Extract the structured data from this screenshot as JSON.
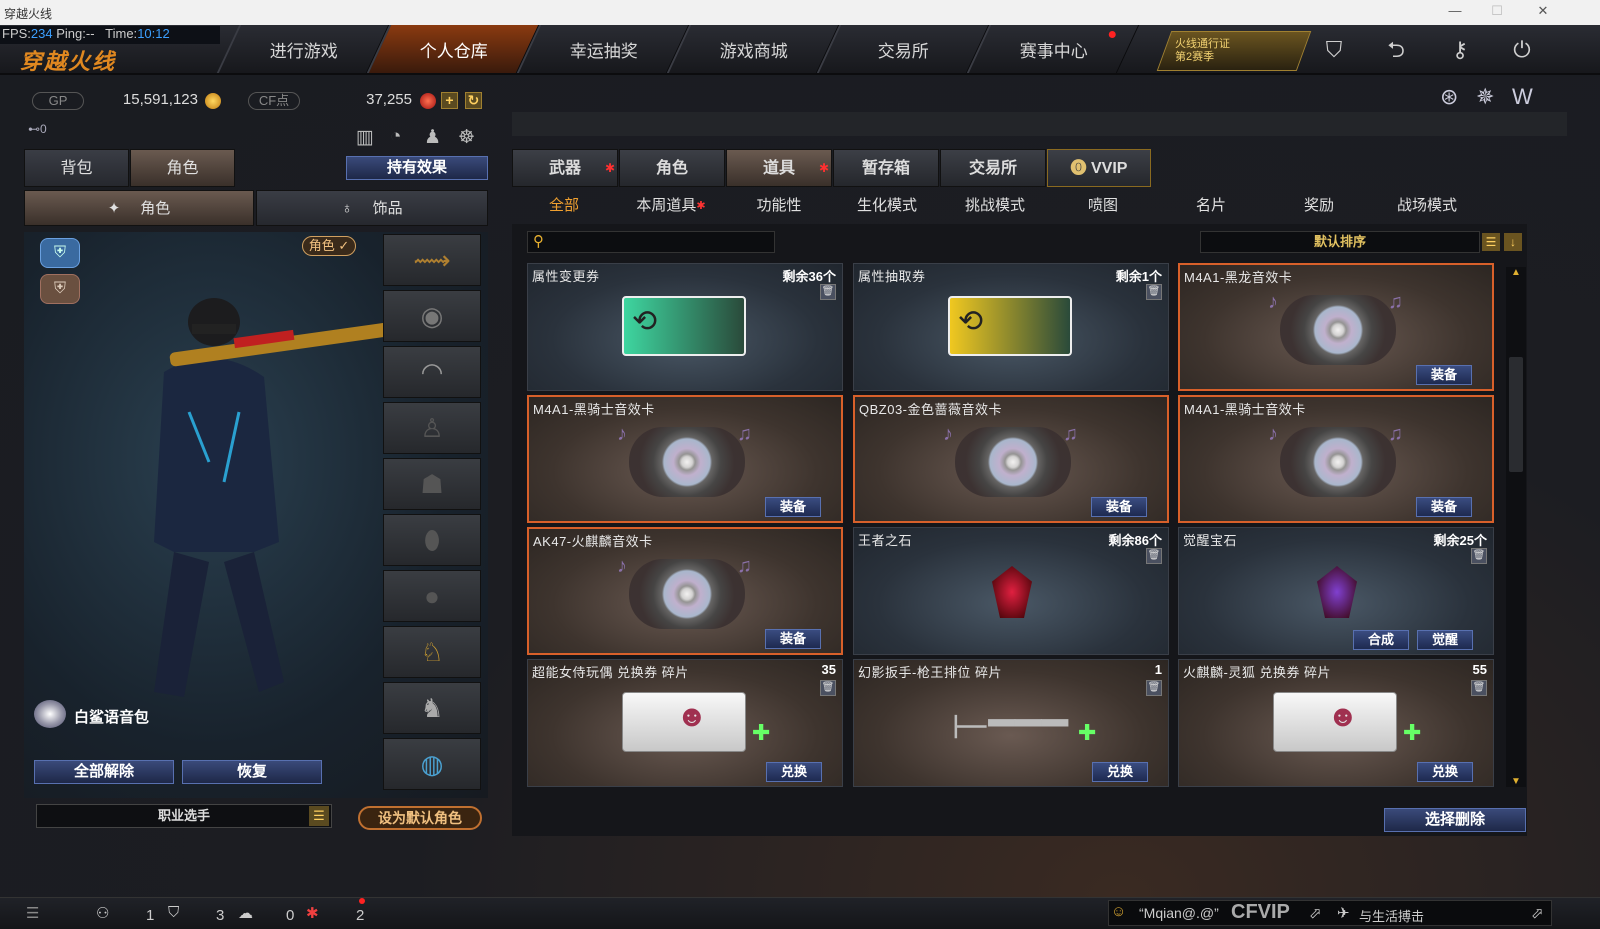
{
  "window": {
    "title": "穿越火线",
    "minimize": "—",
    "maximize": "☐",
    "close": "✕"
  },
  "hud": {
    "fps_label": "FPS:",
    "fps": "234",
    "ping_label": "Ping:",
    "ping": "--",
    "time_label": "Time:",
    "time": "10:12"
  },
  "logo": "穿越火线",
  "nav": {
    "tabs": [
      "进行游戏",
      "个人仓库",
      "幸运抽奖",
      "游戏商城",
      "交易所",
      "赛事中心"
    ],
    "active": 1,
    "battlepass": "火线通行证\n第2赛季"
  },
  "currency": {
    "gp_label": "GP",
    "gp": "15,591,123",
    "cf_label": "CF点",
    "cf": "37,255"
  },
  "key_indicator": "⊷0",
  "left": {
    "tabs": [
      "背包",
      "角色"
    ],
    "active_tab": 1,
    "effects_button": "持有效果",
    "subtabs": [
      "角色",
      "饰品"
    ],
    "role_badge": "角色 ✓",
    "voice_pack": "白鲨语音包",
    "unequip_all": "全部解除",
    "restore": "恢复",
    "profession": "职业选手",
    "set_default": "设为默认角色"
  },
  "right": {
    "tabs": [
      "武器",
      "角色",
      "道具",
      "暂存箱",
      "交易所",
      "VVIP"
    ],
    "active_tab": 2,
    "subtabs": [
      "全部",
      "本周道具",
      "功能性",
      "生化模式",
      "挑战模式",
      "喷图",
      "名片",
      "奖励",
      "战场模式"
    ],
    "active_subtab": 0,
    "search_placeholder": "",
    "sort": "默认排序",
    "delete_button": "选择删除"
  },
  "items": [
    {
      "name": "属性变更券",
      "count": "剩余36个",
      "type": "ticket",
      "color": "#3ed6a0"
    },
    {
      "name": "属性抽取券",
      "count": "剩余1个",
      "type": "ticket",
      "color": "#f0c820"
    },
    {
      "name": "M4A1-黑龙音效卡",
      "button": "装备",
      "type": "disc"
    },
    {
      "name": "M4A1-黑骑士音效卡",
      "button": "装备",
      "type": "disc"
    },
    {
      "name": "QBZ03-金色蔷薇音效卡",
      "button": "装备",
      "type": "disc"
    },
    {
      "name": "M4A1-黑骑士音效卡",
      "button": "装备",
      "type": "disc"
    },
    {
      "name": "AK47-火麒麟音效卡",
      "button": "装备",
      "type": "disc"
    },
    {
      "name": "王者之石",
      "count": "剩余86个",
      "type": "gem",
      "color": "#e02040"
    },
    {
      "name": "觉醒宝石",
      "count": "剩余25个",
      "buttons": [
        "合成",
        "觉醒"
      ],
      "type": "gem",
      "color": "#8040d0"
    },
    {
      "name": "超能女侍玩偶 兑换券 碎片",
      "count": "35",
      "button": "兑换",
      "type": "coupon"
    },
    {
      "name": "幻影扳手-枪王排位 碎片",
      "count": "1",
      "button": "兑换",
      "type": "wrench"
    },
    {
      "name": "火麒麟-灵狐 兑换券 碎片",
      "count": "55",
      "button": "兑换",
      "type": "coupon"
    }
  ],
  "bottom": {
    "c1": "1",
    "c2": "3",
    "c3": "0",
    "c4": "2",
    "chat_name": "“Mqian@.@”",
    "chat_tag": "CFVIP",
    "chat_msg": "与生活搏击"
  }
}
